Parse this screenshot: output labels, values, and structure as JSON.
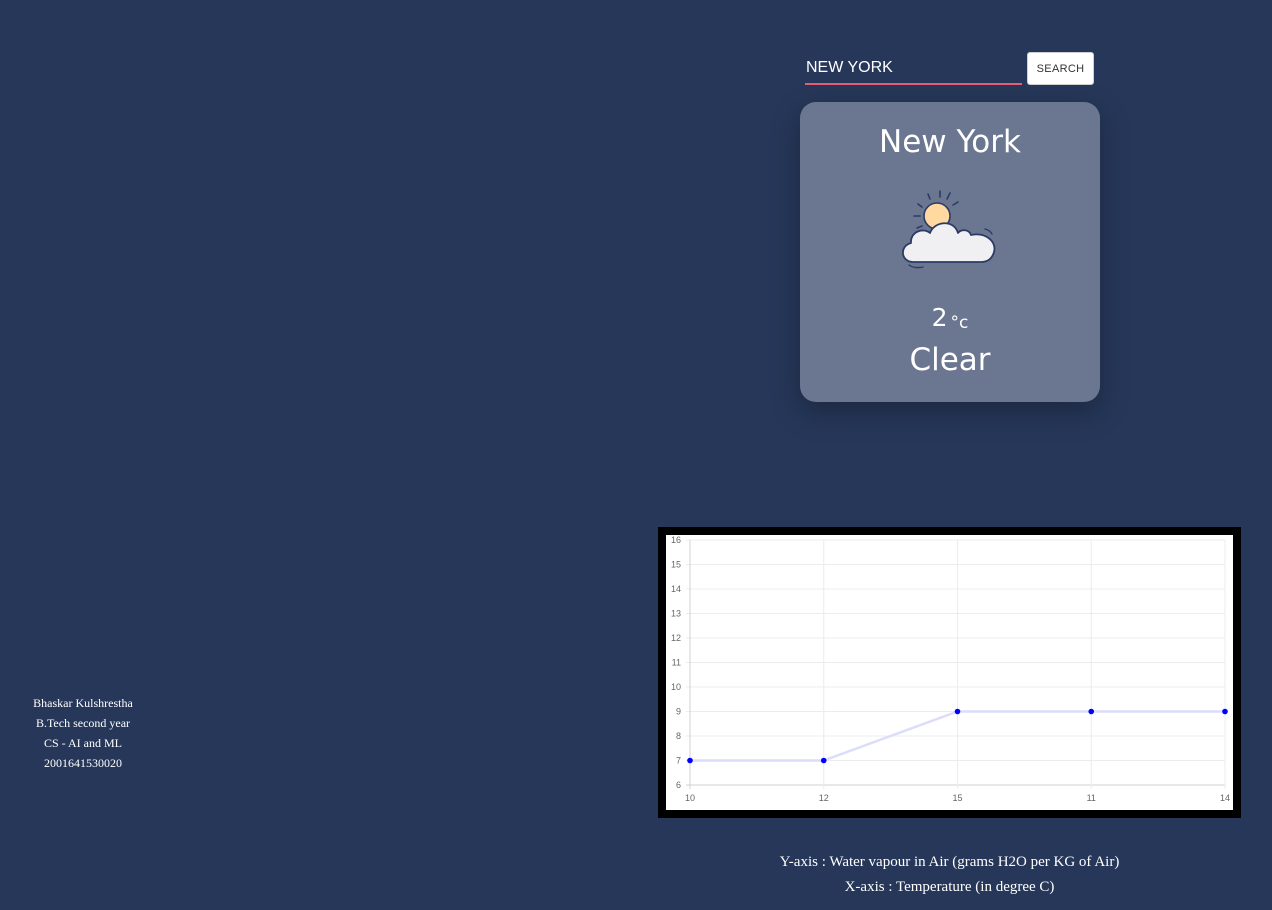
{
  "search": {
    "value": "NEW YORK",
    "button_label": "SEARCH"
  },
  "weather": {
    "city": "New York",
    "temperature": "2",
    "unit": "°c",
    "condition": "Clear",
    "icon": "partly-cloudy-icon"
  },
  "author": {
    "name": "Bhaskar Kulshrestha",
    "course": "B.Tech second year",
    "branch": "CS - AI and ML",
    "roll": "2001641530020"
  },
  "notes": {
    "y_axis": "Y-axis : Water vapour in Air (grams H2O per KG of Air)",
    "x_axis": "X-axis : Temperature (in degree C)"
  },
  "colors": {
    "background": "#263759",
    "card": "#6b7690",
    "search_underline": "#e85d75",
    "point": "#0000ff",
    "line": "#dcdcfb"
  },
  "chart_data": {
    "type": "line",
    "categories": [
      "10",
      "12",
      "15",
      "11",
      "14"
    ],
    "values": [
      7,
      7,
      9,
      9,
      9
    ],
    "ylim": [
      6,
      16
    ],
    "yticks": [
      6,
      7,
      8,
      9,
      10,
      11,
      12,
      13,
      14,
      15,
      16
    ],
    "grid": true
  }
}
